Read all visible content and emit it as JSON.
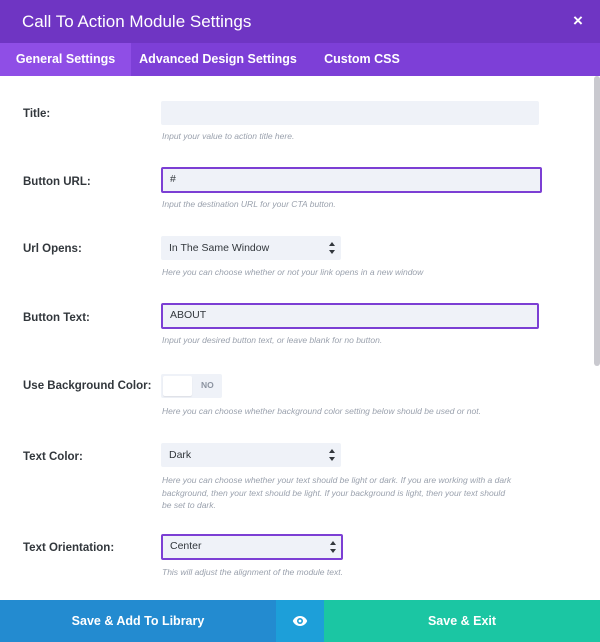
{
  "window": {
    "title": "Call To Action Module Settings",
    "close_label": "×"
  },
  "tabs": [
    {
      "label": "General Settings",
      "active": true
    },
    {
      "label": "Advanced Design Settings",
      "active": false
    },
    {
      "label": "Custom CSS",
      "active": false
    }
  ],
  "fields": {
    "title": {
      "label": "Title:",
      "value": "",
      "help": "Input your value to action title here."
    },
    "button_url": {
      "label": "Button URL:",
      "value": "#",
      "help": "Input the destination URL for your CTA button."
    },
    "url_opens": {
      "label": "Url Opens:",
      "value": "In The Same Window",
      "help": "Here you can choose whether or not your link opens in a new window"
    },
    "button_text": {
      "label": "Button Text:",
      "value": "ABOUT",
      "help": "Input your desired button text, or leave blank for no button."
    },
    "use_background_color": {
      "label": "Use Background Color:",
      "value": "NO",
      "help": "Here you can choose whether background color setting below should be used or not."
    },
    "text_color": {
      "label": "Text Color:",
      "value": "Dark",
      "help": "Here you can choose whether your text should be light or dark. If you are working with a dark background, then your text should be light. If your background is light, then your text should be set to dark."
    },
    "text_orientation": {
      "label": "Text Orientation:",
      "value": "Center",
      "help": "This will adjust the alignment of the module text."
    }
  },
  "footer": {
    "save_library_label": "Save & Add To Library",
    "preview_icon": "eye-icon",
    "save_exit_label": "Save & Exit"
  },
  "colors": {
    "header": "#6f35c3",
    "tabbar": "#7d3fd7",
    "active_tab": "#8f4ee6",
    "focus_border": "#7c3fd4",
    "library_button": "#238bd0",
    "preview_button": "#1d9fd9",
    "save_button": "#1bc6a3"
  }
}
